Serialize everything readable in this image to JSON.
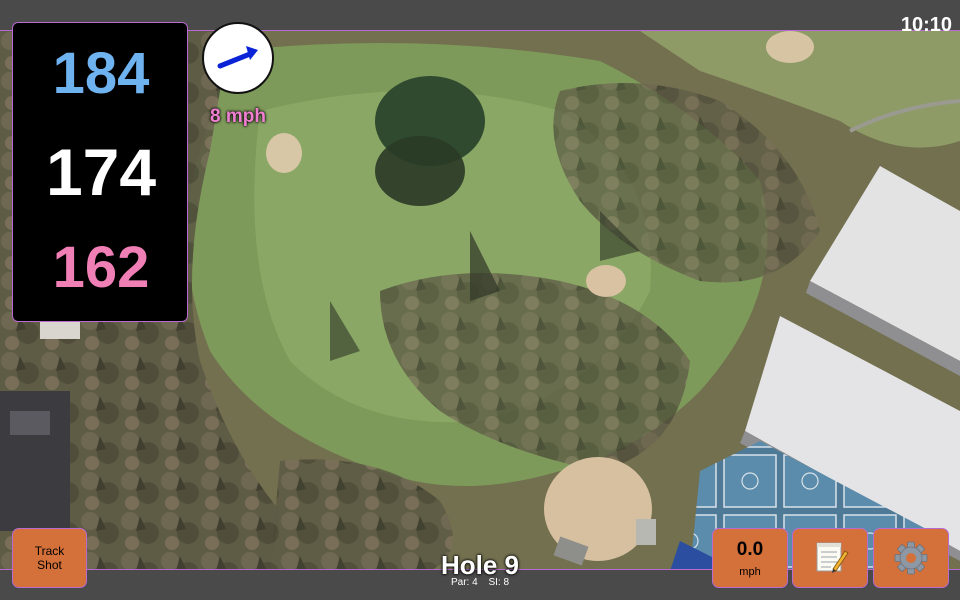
{
  "status_bar": {
    "time": "10:10"
  },
  "distances": {
    "back": "184",
    "middle": "174",
    "front": "162",
    "colors": {
      "back": "#6fb2f0",
      "middle": "#ffffff",
      "front": "#f07fb6"
    }
  },
  "wind": {
    "speed_label": "8 mph",
    "arrow_icon": "wind-direction-arrow-icon",
    "arrow_color": "#0a23d6",
    "label_color": "#f07fd2"
  },
  "hole": {
    "title": "Hole 9",
    "par_label": "Par: 4",
    "si_label": "SI: 8"
  },
  "buttons": {
    "track_shot_line1": "Track",
    "track_shot_line2": "Shot",
    "speed_value": "0.0",
    "speed_unit": "mph",
    "notes_icon": "notepad-icon",
    "settings_icon": "gear-icon",
    "button_color": "#d4703a"
  },
  "map": {
    "kind": "aerial satellite view of golf hole"
  }
}
